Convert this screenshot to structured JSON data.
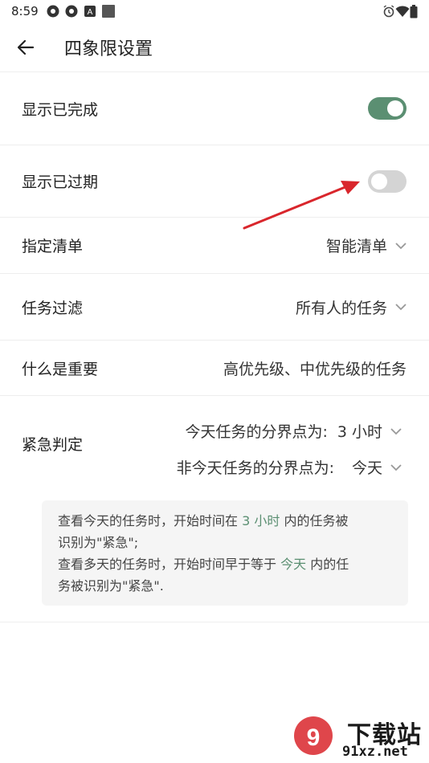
{
  "status_bar": {
    "time": "8:59",
    "left_icons": [
      "app-icon",
      "app-icon",
      "a-icon",
      "square-icon"
    ],
    "right_icons": [
      "alarm-icon",
      "wifi-icon",
      "battery-icon"
    ]
  },
  "header": {
    "title": "四象限设置"
  },
  "rows": {
    "show_completed": {
      "label": "显示已完成",
      "on": true
    },
    "show_overdue": {
      "label": "显示已过期",
      "on": false
    },
    "list": {
      "label": "指定清单",
      "value": "智能清单"
    },
    "filter": {
      "label": "任务过滤",
      "value": "所有人的任务"
    },
    "important": {
      "label": "什么是重要",
      "value": "高优先级、中优先级的任务"
    }
  },
  "urgency": {
    "label": "紧急判定",
    "today_label": "今天任务的分界点为:",
    "today_value": "3 小时",
    "multi_label": "非今天任务的分界点为:",
    "multi_value": "今天",
    "note": {
      "l1_a": "查看今天的任务时，开始时间在",
      "l1_hl": "3 小时",
      "l1_b": "内的任务被",
      "l2": "识别为\"紧急\";",
      "l3_a": "查看多天的任务时，开始时间早于等于",
      "l3_hl": "今天",
      "l3_b": "内的任",
      "l4": "务被识别为\"紧急\"."
    }
  },
  "colors": {
    "accent": "#5b8f72",
    "toggle_off": "#d4d4d4",
    "arrow": "#d9262c"
  },
  "watermark": {
    "brand": "下载站",
    "url": "91xz.net"
  }
}
